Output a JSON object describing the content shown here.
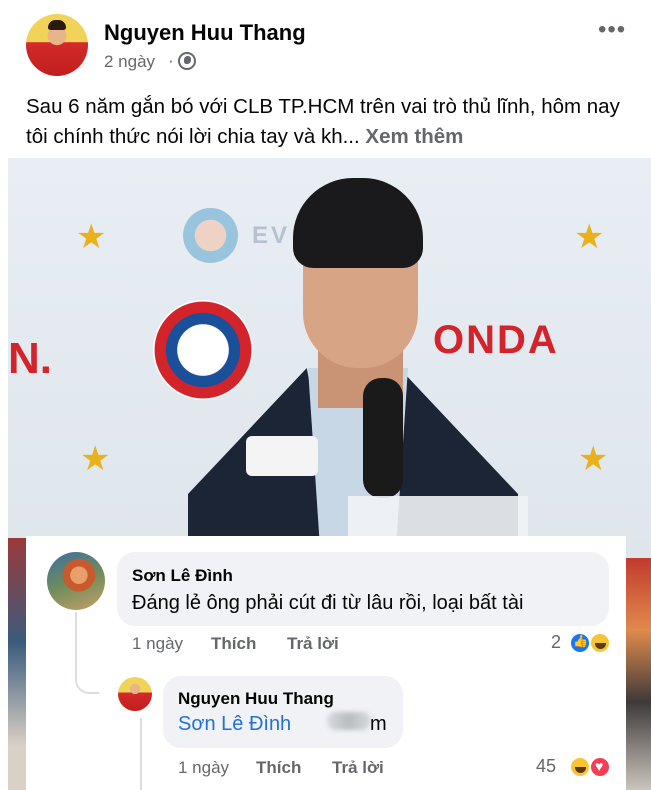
{
  "post": {
    "author": "Nguyen Huu Thang",
    "time": "2 ngày",
    "separator": "·",
    "text": "Sau 6 năm gắn bó với CLB TP.HCM trên vai trò thủ lĩnh, hôm nay tôi chính thức nói lời chia tay và kh...",
    "see_more": "Xem thêm"
  },
  "photo_text": {
    "honda": "ONDA",
    "on": "N.",
    "asia": "EV      ASIA"
  },
  "comments": [
    {
      "author": "Sơn Lê Đình",
      "text": "Đáng lẻ ông phải cút đi từ lâu rồi, loại bất tài",
      "time": "1 ngày",
      "like_label": "Thích",
      "reply_label": "Trả lời",
      "reaction_count": "2"
    }
  ],
  "reply": {
    "author": "Nguyen Huu Thang",
    "tag": "Sơn Lê Đình",
    "text_suffix": "m",
    "time": "1 ngày",
    "like_label": "Thích",
    "reply_label": "Trả lời",
    "reaction_count": "45"
  },
  "colors": {
    "link_blue": "#216fdb",
    "muted": "#65676b",
    "bubble": "#f0f2f5"
  },
  "icons": [
    "globe-icon",
    "more-icon",
    "like-icon",
    "haha-icon",
    "love-icon"
  ]
}
